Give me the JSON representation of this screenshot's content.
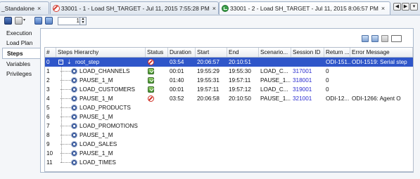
{
  "tabs": [
    {
      "label": "_Standalone",
      "close": "×",
      "icon": "none",
      "active": false
    },
    {
      "label": "33001 - 1 - Load SH_TARGET - Jul 11, 2015 7:55:28 PM",
      "close": "×",
      "icon": "error-icon",
      "active": false
    },
    {
      "label": "33001 - 2 - Load SH_TARGET - Jul 11, 2015 8:06:57 PM",
      "close": "×",
      "icon": "success-icon",
      "active": true
    }
  ],
  "nav": {
    "prev": "◀",
    "next": "▶",
    "menu": "▾"
  },
  "toolbar": {
    "refresh_interval": "1"
  },
  "sidebar": {
    "items": [
      {
        "label": "Execution",
        "active": false
      },
      {
        "label": "Load Plan",
        "active": false
      },
      {
        "label": "Steps",
        "active": true
      },
      {
        "label": "Variables",
        "active": false
      },
      {
        "label": "Privileges",
        "active": false
      }
    ]
  },
  "grid": {
    "columns": [
      "#",
      "Steps Hierarchy",
      "Status",
      "Duration",
      "Start",
      "End",
      "Scenario...",
      "Session ID",
      "Return ...",
      "Error Message"
    ],
    "rows": [
      {
        "num": "0",
        "step": "root_step",
        "status": "error",
        "duration": "03:54",
        "start": "20:06:57",
        "end": "20:10:51",
        "scenario": "",
        "session": "",
        "return": "ODI-151...",
        "error": "ODI-1519: Serial step"
      },
      {
        "num": "1",
        "step": "LOAD_CHANNELS",
        "status": "ok",
        "duration": "00:01",
        "start": "19:55:29",
        "end": "19:55:30",
        "scenario": "LOAD_C...",
        "session": "317001",
        "return": "0",
        "error": ""
      },
      {
        "num": "2",
        "step": "PAUSE_1_M",
        "status": "ok",
        "duration": "01:40",
        "start": "19:55:31",
        "end": "19:57:11",
        "scenario": "PAUSE_1...",
        "session": "318001",
        "return": "0",
        "error": ""
      },
      {
        "num": "3",
        "step": "LOAD_CUSTOMERS",
        "status": "ok",
        "duration": "00:01",
        "start": "19:57:11",
        "end": "19:57:12",
        "scenario": "LOAD_C...",
        "session": "319001",
        "return": "0",
        "error": ""
      },
      {
        "num": "4",
        "step": "PAUSE_1_M",
        "status": "error",
        "duration": "03:52",
        "start": "20:06:58",
        "end": "20:10:50",
        "scenario": "PAUSE_1...",
        "session": "321001",
        "return": "ODI-12...",
        "error": "ODI-1266: Agent O"
      },
      {
        "num": "5",
        "step": "LOAD_PRODUCTS",
        "status": "",
        "duration": "",
        "start": "",
        "end": "",
        "scenario": "",
        "session": "",
        "return": "",
        "error": ""
      },
      {
        "num": "6",
        "step": "PAUSE_1_M",
        "status": "",
        "duration": "",
        "start": "",
        "end": "",
        "scenario": "",
        "session": "",
        "return": "",
        "error": ""
      },
      {
        "num": "7",
        "step": "LOAD_PROMOTIONS",
        "status": "",
        "duration": "",
        "start": "",
        "end": "",
        "scenario": "",
        "session": "",
        "return": "",
        "error": ""
      },
      {
        "num": "8",
        "step": "PAUSE_1_M",
        "status": "",
        "duration": "",
        "start": "",
        "end": "",
        "scenario": "",
        "session": "",
        "return": "",
        "error": ""
      },
      {
        "num": "9",
        "step": "LOAD_SALES",
        "status": "",
        "duration": "",
        "start": "",
        "end": "",
        "scenario": "",
        "session": "",
        "return": "",
        "error": ""
      },
      {
        "num": "10",
        "step": "PAUSE_1_M",
        "status": "",
        "duration": "",
        "start": "",
        "end": "",
        "scenario": "",
        "session": "",
        "return": "",
        "error": ""
      },
      {
        "num": "11",
        "step": "LOAD_TIMES",
        "status": "",
        "duration": "",
        "start": "",
        "end": "",
        "scenario": "",
        "session": "",
        "return": "",
        "error": ""
      }
    ]
  },
  "colors": {
    "selection": "#2f56c9",
    "link": "#2a2ccf",
    "error": "#cf2f25",
    "success": "#3e8f29"
  }
}
